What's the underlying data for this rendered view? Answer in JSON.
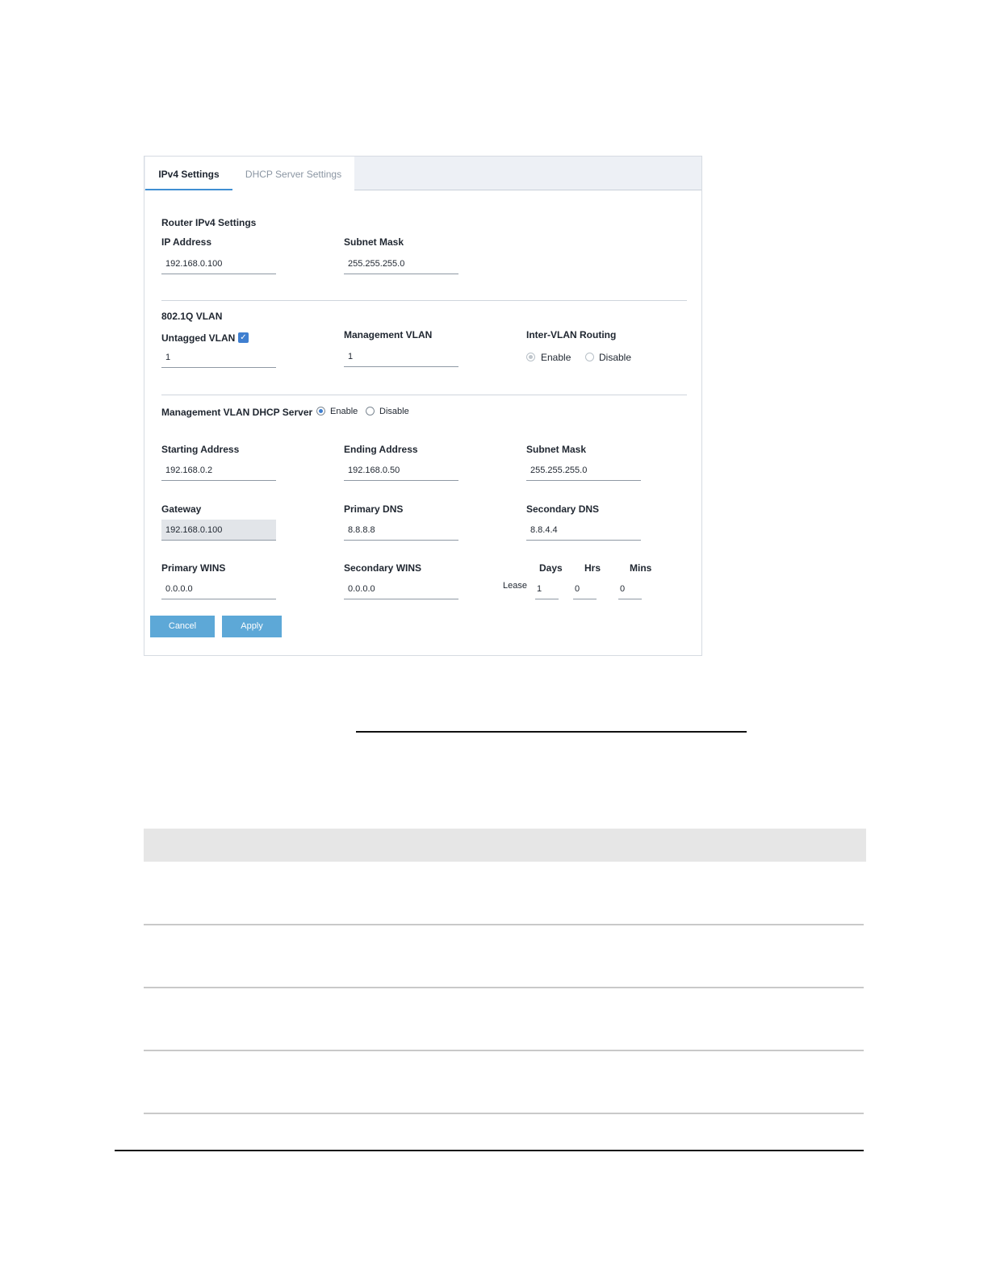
{
  "tabs": [
    {
      "label": "IPv4 Settings",
      "active": true
    },
    {
      "label": "DHCP Server Settings",
      "active": false
    }
  ],
  "router_ipv4": {
    "section_title": "Router IPv4 Settings",
    "ip_address_label": "IP Address",
    "ip_address_value": "192.168.0.100",
    "subnet_mask_label": "Subnet Mask",
    "subnet_mask_value": "255.255.255.0"
  },
  "vlan": {
    "section_title": "802.1Q VLAN",
    "untagged_label": "Untagged VLAN",
    "untagged_checked": true,
    "untagged_value": "1",
    "management_label": "Management VLAN",
    "management_value": "1",
    "inter_vlan_label": "Inter-VLAN Routing",
    "enable_label": "Enable",
    "disable_label": "Disable",
    "inter_vlan_selected": "Enable"
  },
  "dhcp": {
    "server_label": "Management VLAN DHCP Server",
    "enable_label": "Enable",
    "disable_label": "Disable",
    "selected": "Enable",
    "starting_label": "Starting Address",
    "starting_value": "192.168.0.2",
    "ending_label": "Ending Address",
    "ending_value": "192.168.0.50",
    "subnet_label": "Subnet Mask",
    "subnet_value": "255.255.255.0",
    "gateway_label": "Gateway",
    "gateway_value": "192.168.0.100",
    "primary_dns_label": "Primary DNS",
    "primary_dns_value": "8.8.8.8",
    "secondary_dns_label": "Secondary DNS",
    "secondary_dns_value": "8.8.4.4",
    "primary_wins_label": "Primary WINS",
    "primary_wins_value": "0.0.0.0",
    "secondary_wins_label": "Secondary WINS",
    "secondary_wins_value": "0.0.0.0",
    "lease_label": "Lease",
    "days_label": "Days",
    "days_value": "1",
    "hrs_label": "Hrs",
    "hrs_value": "0",
    "mins_label": "Mins",
    "mins_value": "0"
  },
  "buttons": {
    "cancel": "Cancel",
    "apply": "Apply"
  },
  "colors": {
    "accent": "#3f7fd0",
    "button": "#5da8d7",
    "tab_bar": "#edf0f5",
    "disabled_field": "#e2e5e9"
  }
}
